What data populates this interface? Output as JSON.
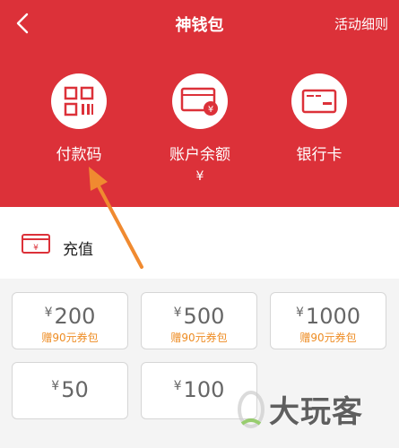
{
  "header": {
    "title": "神钱包",
    "rules_link": "活动细则"
  },
  "features": [
    {
      "label": "付款码",
      "icon": "qr-code-icon"
    },
    {
      "label": "账户余额",
      "sub": "¥",
      "icon": "wallet-yen-icon"
    },
    {
      "label": "银行卡",
      "icon": "bank-card-icon"
    }
  ],
  "recharge": {
    "label": "充值",
    "icon": "recharge-card-icon"
  },
  "amounts": [
    {
      "currency": "¥",
      "value": "200",
      "bonus": "赠90元券包"
    },
    {
      "currency": "¥",
      "value": "500",
      "bonus": "赠90元券包"
    },
    {
      "currency": "¥",
      "value": "1000",
      "bonus": "赠90元券包"
    },
    {
      "currency": "¥",
      "value": "50"
    },
    {
      "currency": "¥",
      "value": "100"
    }
  ],
  "watermark": {
    "text": "大玩客"
  },
  "colors": {
    "header_red": "#dc3139",
    "bonus_orange": "#ee8c23",
    "arrow_orange": "#f08a30"
  }
}
